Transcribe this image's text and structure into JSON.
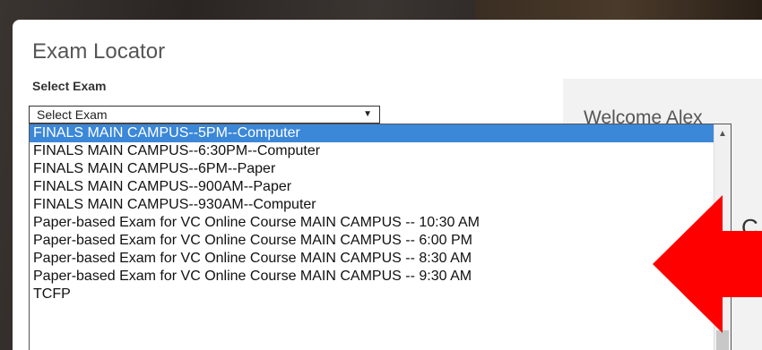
{
  "page": {
    "title": "Exam Locator"
  },
  "form": {
    "label": "Select Exam",
    "select_value": "Select Exam",
    "arrow_glyph": "▼"
  },
  "dropdown": {
    "options": [
      "FINALS MAIN CAMPUS--5PM--Computer",
      "FINALS MAIN CAMPUS--6:30PM--Computer",
      "FINALS MAIN CAMPUS--6PM--Paper",
      "FINALS MAIN CAMPUS--900AM--Paper",
      "FINALS MAIN CAMPUS--930AM--Computer",
      "Paper-based Exam for VC Online Course MAIN CAMPUS -- 10:30 AM",
      "Paper-based Exam for VC Online Course MAIN CAMPUS -- 6:00 PM",
      "Paper-based Exam for VC Online Course MAIN CAMPUS -- 8:30 AM",
      "Paper-based Exam for VC Online Course MAIN CAMPUS -- 9:30 AM",
      "TCFP"
    ],
    "selected_index": 0,
    "scroll_up_glyph": "▲"
  },
  "sidebar": {
    "welcome_text": "Welcome Alex",
    "partial_char": "C"
  },
  "annotation": {
    "arrow_color": "#ff0000"
  },
  "colors": {
    "selection": "#3b87d8"
  }
}
